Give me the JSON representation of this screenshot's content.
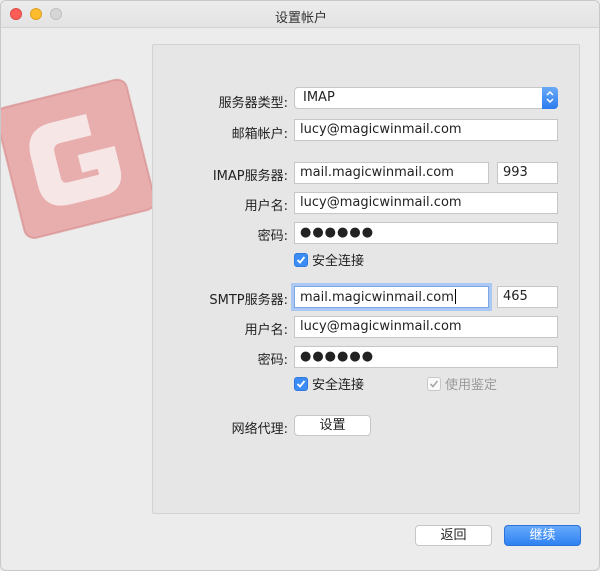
{
  "window": {
    "title": "设置帐户"
  },
  "form": {
    "server_type_label": "服务器类型:",
    "server_type_value": "IMAP",
    "email_label": "邮箱帐户:",
    "email_value": "lucy@magicwinmail.com",
    "imap": {
      "server_label": "IMAP服务器:",
      "server_value": "mail.magicwinmail.com",
      "port_value": "993",
      "username_label": "用户名:",
      "username_value": "lucy@magicwinmail.com",
      "password_label": "密码:",
      "password_value": "●●●●●●",
      "secure_label": "安全连接"
    },
    "smtp": {
      "server_label": "SMTP服务器:",
      "server_value": "mail.magicwinmail.com",
      "port_value": "465",
      "username_label": "用户名:",
      "username_value": "lucy@magicwinmail.com",
      "password_label": "密码:",
      "password_value": "●●●●●●",
      "secure_label": "安全连接",
      "auth_label": "使用鉴定"
    },
    "proxy_label": "网络代理:",
    "proxy_button": "设置"
  },
  "footer": {
    "back_label": "返回",
    "continue_label": "继续"
  },
  "colors": {
    "accent": "#2f82f2",
    "logo": "#e8a3a3"
  },
  "icons": {
    "logo": "magicwinmail-logo-icon",
    "checkmark": "checkmark-icon",
    "select": "chevron-updown-icon"
  }
}
